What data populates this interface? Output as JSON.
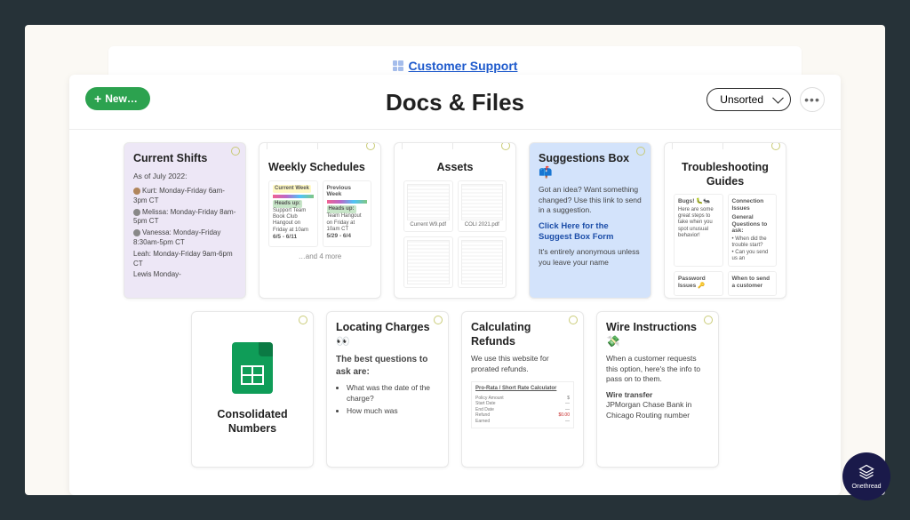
{
  "breadcrumb": {
    "label": "Customer Support"
  },
  "page": {
    "title": "Docs & Files"
  },
  "toolbar": {
    "new_label": "New…",
    "sort_selected": "Unsorted",
    "more_label": "•••"
  },
  "cards": {
    "current_shifts": {
      "title": "Current Shifts",
      "as_of": "As of July 2022:",
      "people": [
        "Kurt: Monday-Friday 6am-3pm CT",
        "Melissa: Monday-Friday 8am-5pm CT",
        "Vanessa: Monday-Friday 8:30am-5pm CT",
        "Leah: Monday-Friday 9am-6pm CT",
        "Lewis Monday-"
      ]
    },
    "weekly_schedules": {
      "title": "Weekly Schedules",
      "sub1": {
        "badge": "Current Week",
        "heads": "Heads up:",
        "body": "Support Team Book Club Hangout on Friday at 10am",
        "dates": "6/5 - 6/11"
      },
      "sub2": {
        "badge": "Previous Week",
        "heads": "Heads up:",
        "body": "Team Hangout on Friday at 10am CT",
        "dates": "5/29 - 6/4"
      },
      "more": "…and 4 more"
    },
    "assets": {
      "title": "Assets",
      "thumb1": "Current W9.pdf",
      "thumb2": "COLI 2021.pdf"
    },
    "suggestions": {
      "title": "Suggestions Box 📫",
      "body1": "Got an idea? Want something changed? Use this link to send in a suggestion.",
      "link": "Click Here for the Suggest Box Form",
      "body2": "It's entirely anonymous unless you leave your name"
    },
    "troubleshooting": {
      "title": "Troubleshooting Guides",
      "sub1": {
        "t": "Bugs! 🐛🐜",
        "body": "Here are some great steps to take when you spot unusual behavior!"
      },
      "sub2": {
        "t": "Connection Issues",
        "body": "General Questions to ask:",
        "li1": "When did the trouble start?",
        "li2": "Can you send us an"
      },
      "sub3": {
        "t": "Password Issues 🔑"
      },
      "sub4": {
        "t": "When to send a customer"
      }
    },
    "consolidated": {
      "title": "Consolidated Numbers"
    },
    "locating": {
      "title": "Locating Charges 👀",
      "sub": "The best questions to ask are:",
      "b1": "What was the date of the charge?",
      "b2": "How much was"
    },
    "refunds": {
      "title": "Calculating Refunds",
      "body": "We use this website for prorated refunds.",
      "thumb_title": "Pro-Rata / Short Rate Calculator"
    },
    "wire": {
      "title": "Wire Instructions 💸",
      "body": "When a customer requests this option, here's the info to pass on to them.",
      "h2": "Wire transfer",
      "line": "JPMorgan Chase Bank in Chicago Routing number"
    }
  },
  "brand": "Onethread"
}
